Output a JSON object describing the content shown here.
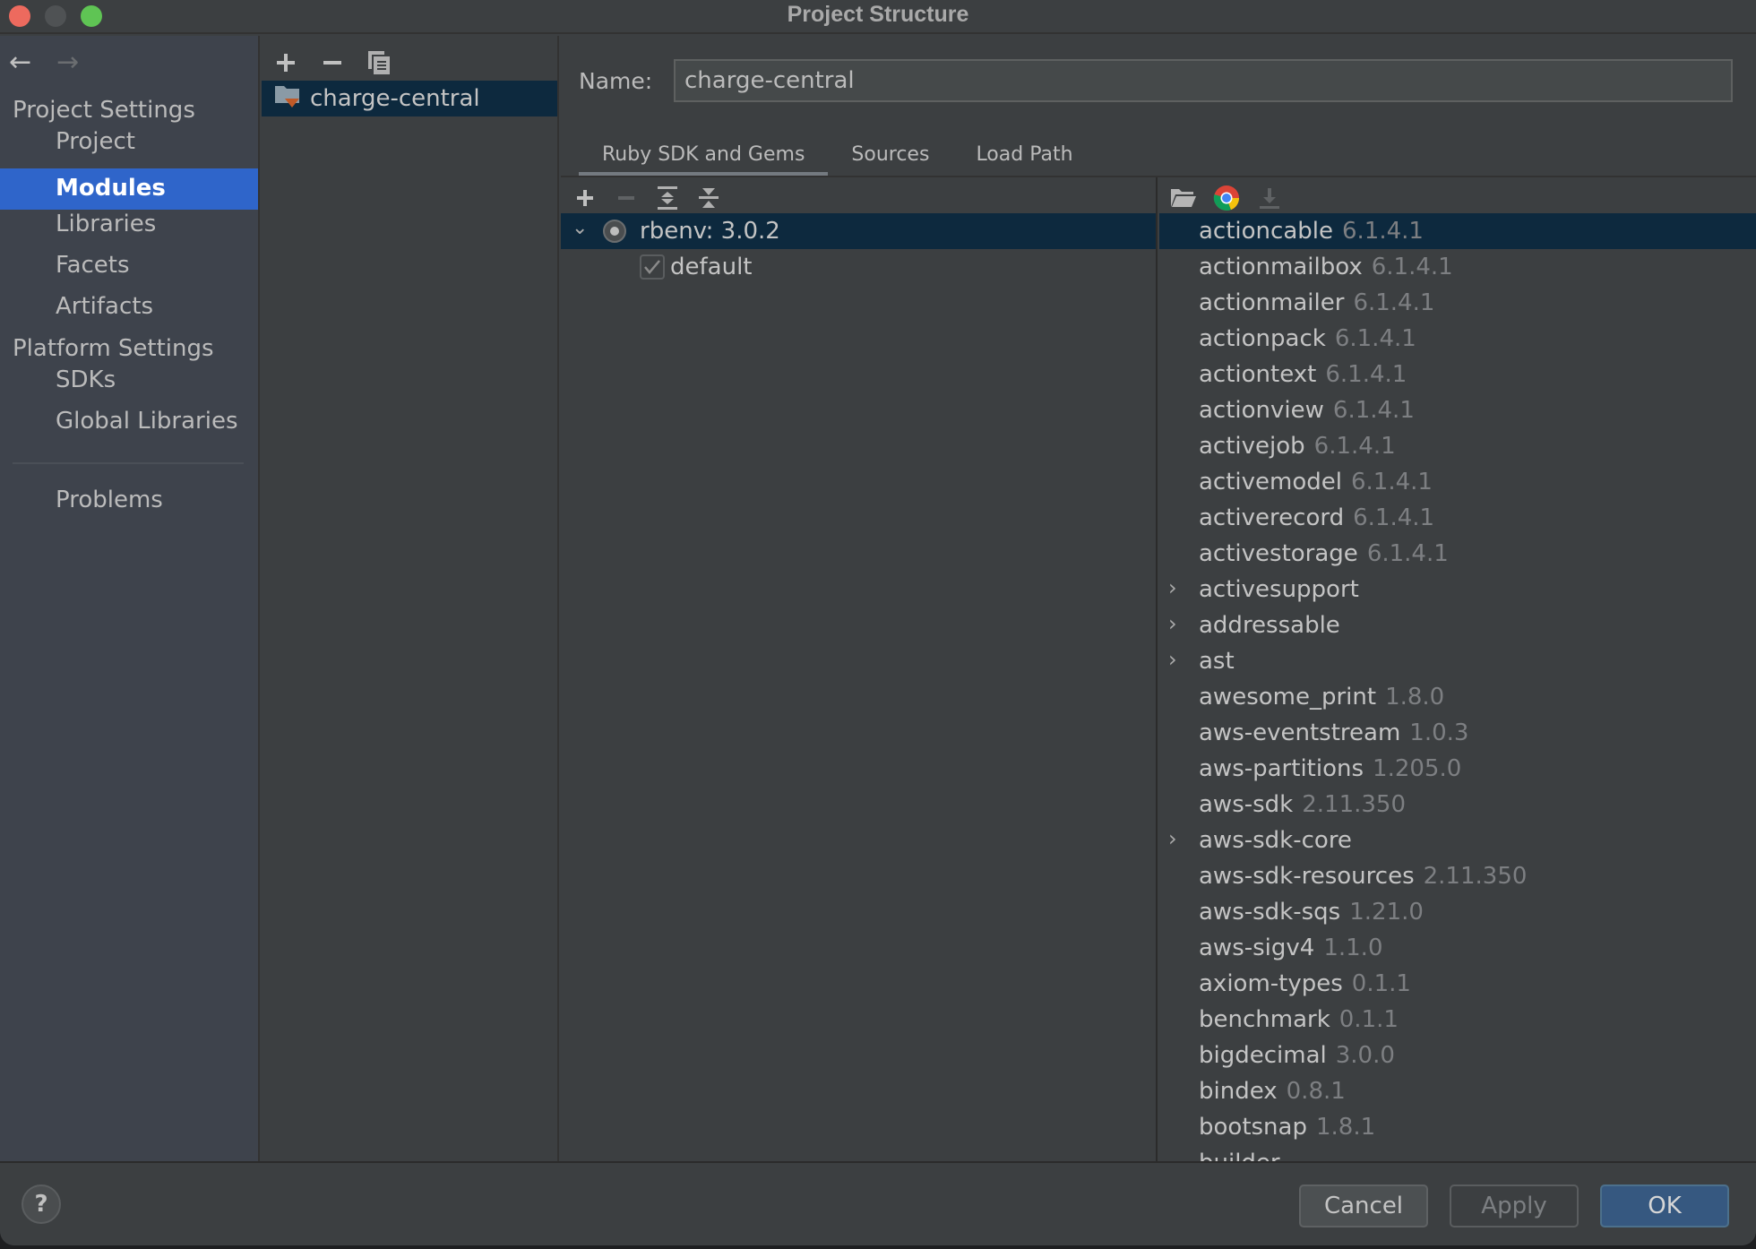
{
  "window": {
    "title": "Project Structure"
  },
  "sidebar": {
    "nav": {
      "back_icon": "arrow-left-icon",
      "forward_icon": "arrow-right-icon"
    },
    "project_settings_header": "Project Settings",
    "project_items": [
      {
        "label": "Project",
        "active": false
      },
      {
        "label": "Modules",
        "active": true
      },
      {
        "label": "Libraries",
        "active": false
      },
      {
        "label": "Facets",
        "active": false
      },
      {
        "label": "Artifacts",
        "active": false
      }
    ],
    "platform_settings_header": "Platform Settings",
    "platform_items": [
      {
        "label": "SDKs"
      },
      {
        "label": "Global Libraries"
      }
    ],
    "problems_label": "Problems"
  },
  "modules": {
    "toolbar": [
      "add-icon",
      "remove-icon",
      "copy-icon"
    ],
    "items": [
      {
        "label": "charge-central",
        "icon": "module-folder-icon",
        "selected": true
      }
    ]
  },
  "detail": {
    "name_label": "Name:",
    "name_value": "charge-central",
    "tabs": [
      {
        "label": "Ruby SDK and Gems",
        "active": true
      },
      {
        "label": "Sources",
        "active": false
      },
      {
        "label": "Load Path",
        "active": false
      }
    ],
    "sdk_tree": {
      "toolbar": [
        "add-icon",
        "remove-icon",
        "expand-all-icon",
        "collapse-all-icon"
      ],
      "sdk": {
        "label": "rbenv: 3.0.2",
        "expanded": true,
        "selected": true
      },
      "gemsets": [
        {
          "label": "default",
          "checked": true
        }
      ]
    },
    "gems": {
      "toolbar": [
        "open-folder-icon",
        "chrome-icon",
        "download-icon"
      ],
      "items": [
        {
          "name": "actioncable",
          "version": "6.1.4.1",
          "expandable": false
        },
        {
          "name": "actionmailbox",
          "version": "6.1.4.1",
          "expandable": false
        },
        {
          "name": "actionmailer",
          "version": "6.1.4.1",
          "expandable": false
        },
        {
          "name": "actionpack",
          "version": "6.1.4.1",
          "expandable": false
        },
        {
          "name": "actiontext",
          "version": "6.1.4.1",
          "expandable": false
        },
        {
          "name": "actionview",
          "version": "6.1.4.1",
          "expandable": false
        },
        {
          "name": "activejob",
          "version": "6.1.4.1",
          "expandable": false
        },
        {
          "name": "activemodel",
          "version": "6.1.4.1",
          "expandable": false
        },
        {
          "name": "activerecord",
          "version": "6.1.4.1",
          "expandable": false
        },
        {
          "name": "activestorage",
          "version": "6.1.4.1",
          "expandable": false
        },
        {
          "name": "activesupport",
          "version": "",
          "expandable": true
        },
        {
          "name": "addressable",
          "version": "",
          "expandable": true
        },
        {
          "name": "ast",
          "version": "",
          "expandable": true
        },
        {
          "name": "awesome_print",
          "version": "1.8.0",
          "expandable": false
        },
        {
          "name": "aws-eventstream",
          "version": "1.0.3",
          "expandable": false
        },
        {
          "name": "aws-partitions",
          "version": "1.205.0",
          "expandable": false
        },
        {
          "name": "aws-sdk",
          "version": "2.11.350",
          "expandable": false
        },
        {
          "name": "aws-sdk-core",
          "version": "",
          "expandable": true
        },
        {
          "name": "aws-sdk-resources",
          "version": "2.11.350",
          "expandable": false
        },
        {
          "name": "aws-sdk-sqs",
          "version": "1.21.0",
          "expandable": false
        },
        {
          "name": "aws-sigv4",
          "version": "1.1.0",
          "expandable": false
        },
        {
          "name": "axiom-types",
          "version": "0.1.1",
          "expandable": false
        },
        {
          "name": "benchmark",
          "version": "0.1.1",
          "expandable": false
        },
        {
          "name": "bigdecimal",
          "version": "3.0.0",
          "expandable": false
        },
        {
          "name": "bindex",
          "version": "0.8.1",
          "expandable": false
        },
        {
          "name": "bootsnap",
          "version": "1.8.1",
          "expandable": false
        },
        {
          "name": "builder",
          "version": "",
          "expandable": false
        }
      ]
    }
  },
  "footer": {
    "help_label": "?",
    "cancel_label": "Cancel",
    "apply_label": "Apply",
    "ok_label": "OK"
  }
}
